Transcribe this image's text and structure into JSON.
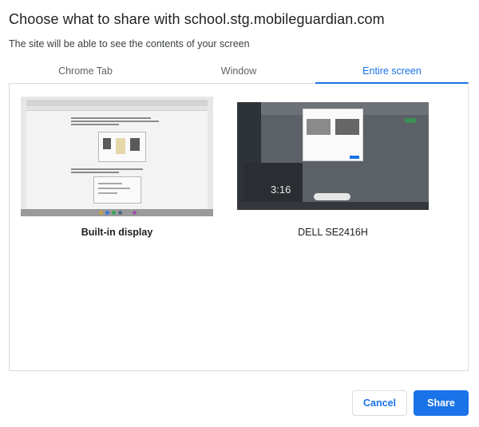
{
  "dialog": {
    "title": "Choose what to share with school.stg.mobileguardian.com",
    "subtitle": "The site will be able to see the contents of your screen"
  },
  "tabs": [
    {
      "label": "Chrome Tab",
      "active": false
    },
    {
      "label": "Window",
      "active": false
    },
    {
      "label": "Entire screen",
      "active": true
    }
  ],
  "sources": [
    {
      "label": "Built-in display",
      "selected": true
    },
    {
      "label": "DELL SE2416H",
      "selected": false
    }
  ],
  "thumbnail_text": {
    "clock": "3:16"
  },
  "buttons": {
    "cancel": "Cancel",
    "share": "Share"
  },
  "colors": {
    "accent": "#1a73e8",
    "border": "#dadce0",
    "text": "#202124",
    "muted": "#5f6368"
  }
}
